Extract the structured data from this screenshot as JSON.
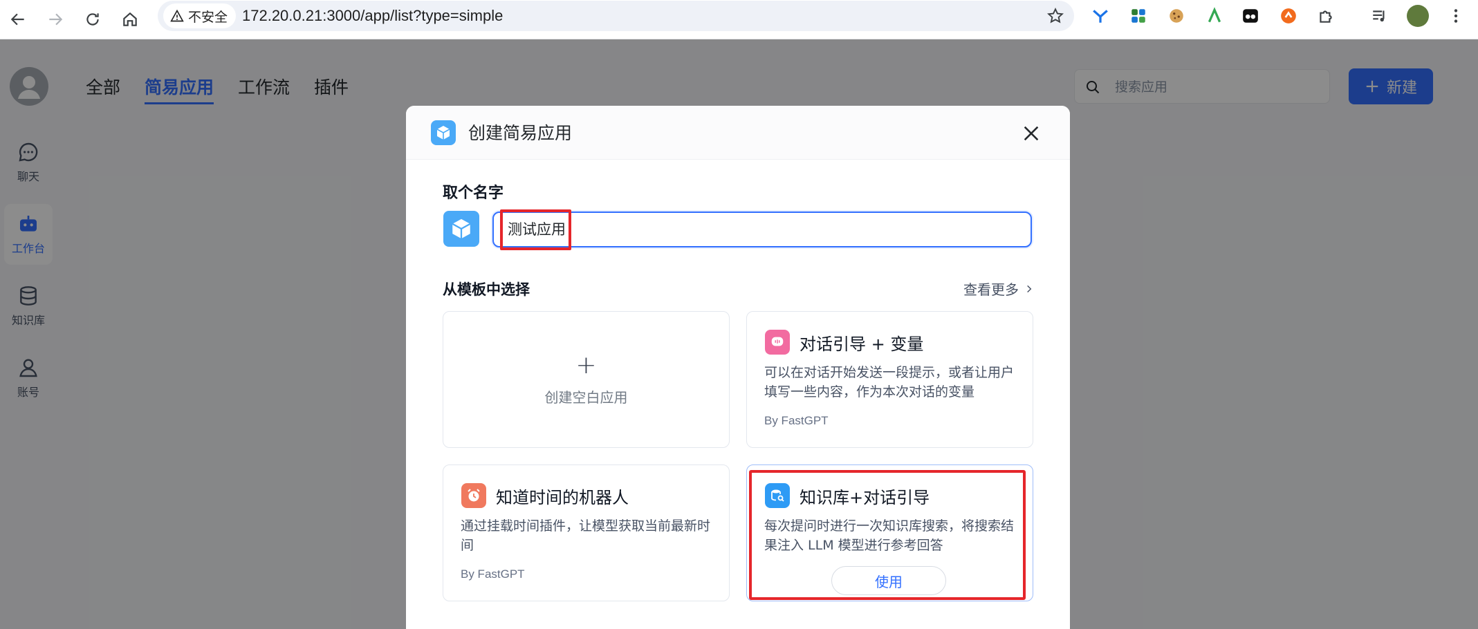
{
  "browser": {
    "security_label": "不安全",
    "url": "172.20.0.21:3000/app/list?type=simple",
    "extensions": [
      "vscode-icon",
      "apps-icon",
      "cookie-icon",
      "android-icon",
      "media-icon",
      "sync-icon",
      "puzzle-icon"
    ]
  },
  "sidebar": {
    "items": [
      {
        "label": "聊天",
        "icon": "chat-icon"
      },
      {
        "label": "工作台",
        "icon": "robot-icon",
        "active": true
      },
      {
        "label": "知识库",
        "icon": "database-icon"
      },
      {
        "label": "账号",
        "icon": "user-icon"
      }
    ]
  },
  "header": {
    "tabs": [
      "全部",
      "简易应用",
      "工作流",
      "插件"
    ],
    "active_tab": "简易应用",
    "search_placeholder": "搜索应用",
    "new_label": "新建"
  },
  "modal": {
    "title": "创建简易应用",
    "name_label": "取个名字",
    "name_value": "测试应用",
    "template_label": "从模板中选择",
    "see_more": "查看更多",
    "blank_card": "创建空白应用",
    "cards": [
      {
        "title": "对话引导 + 变量",
        "desc": "可以在对话开始发送一段提示，或者让用户填写一些内容，作为本次对话的变量",
        "by": "By FastGPT",
        "icon": "chat-bubble-icon",
        "color": "#f26ba0"
      },
      {
        "title": "知道时间的机器人",
        "desc": "通过挂载时间插件，让模型获取当前最新时间",
        "by": "By FastGPT",
        "icon": "alarm-clock-icon",
        "color": "#f0795e"
      },
      {
        "title": "知识库+对话引导",
        "desc": "每次提问时进行一次知识库搜索，将搜索结果注入 LLM 模型进行参考回答",
        "use_label": "使用",
        "icon": "database-search-icon",
        "color": "#2e9bf5"
      }
    ]
  },
  "colors": {
    "accent": "#3370ff",
    "highlight": "#e5262b"
  }
}
